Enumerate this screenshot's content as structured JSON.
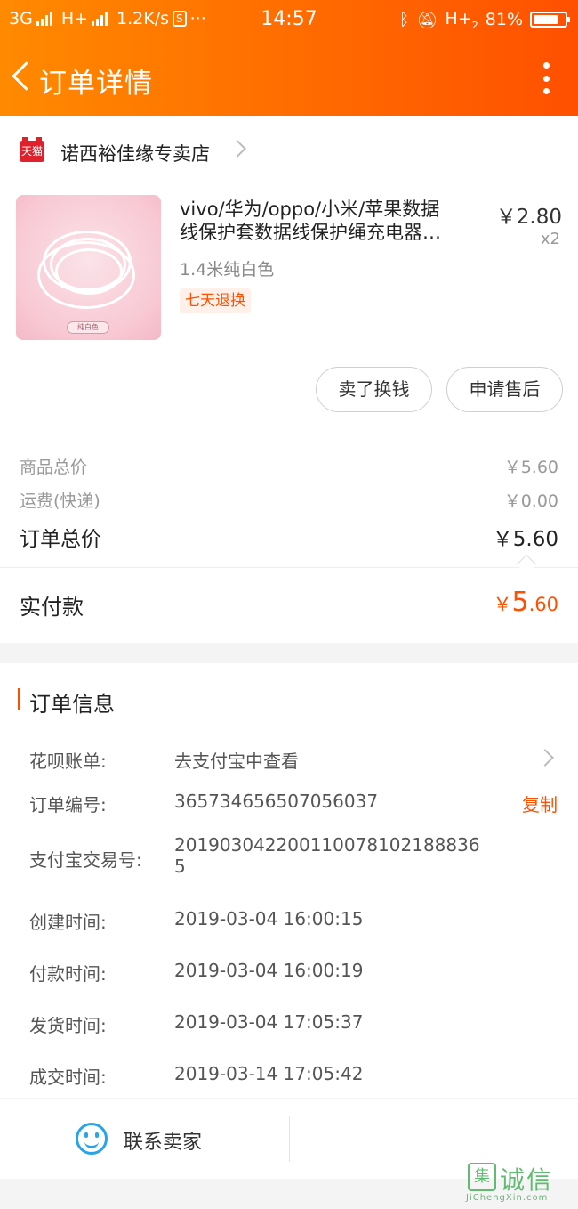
{
  "status_bar": {
    "network1": "3G",
    "network2": "H+",
    "speed": "1.2K/s",
    "s_badge": "S",
    "dots": "···",
    "time": "14:57",
    "net3": "H+",
    "net3_sub": "2",
    "battery": "81%"
  },
  "nav": {
    "title": "订单详情",
    "back_icon": "chevron-left-icon",
    "more_icon": "more-vertical-icon"
  },
  "shop": {
    "badge": "天猫",
    "name": "诺西裕佳缘专卖店"
  },
  "product": {
    "title_line1": "vivo/华为/oppo/小米/苹果数据",
    "title_line2": "线保护套数据线保护绳充电器…",
    "price": "￥2.80",
    "qty": "x2",
    "sku": "1.4米纯白色",
    "tag": "七天退换",
    "thumb_label": "纯白色"
  },
  "actions": {
    "sell": "卖了换钱",
    "after_sale": "申请售后"
  },
  "fees": {
    "goods_label": "商品总价",
    "goods_value": "￥5.60",
    "shipping_label": "运费(快递)",
    "shipping_value": "￥0.00",
    "total_label": "订单总价",
    "total_value": "￥5.60",
    "paid_label": "实付款",
    "paid_currency": "￥",
    "paid_int": "5",
    "paid_dec": ".60"
  },
  "order_info": {
    "section_title": "订单信息",
    "huabei_label": "花呗账单:",
    "huabei_value": "去支付宝中查看",
    "order_no_label": "订单编号:",
    "order_no_value": "365734656507056037",
    "copy": "复制",
    "alipay_label": "支付宝交易号:",
    "alipay_value": "2019030422001100781021888365",
    "created_label": "创建时间:",
    "created_value": "2019-03-04 16:00:15",
    "paid_label": "付款时间:",
    "paid_value": "2019-03-04 16:00:19",
    "shipped_label": "发货时间:",
    "shipped_value": "2019-03-04 17:05:37",
    "closed_label": "成交时间:",
    "closed_value": "2019-03-14 17:05:42"
  },
  "bottom": {
    "contact_label": "联系卖家",
    "contact_icon": "smile-chat-icon"
  },
  "watermark": {
    "glyph": "集",
    "cn": "诚信",
    "en": "JiChengXin.com"
  },
  "colors": {
    "accent": "#ff5000",
    "header_start": "#ff8a00",
    "link_blue": "#29a4e6"
  }
}
